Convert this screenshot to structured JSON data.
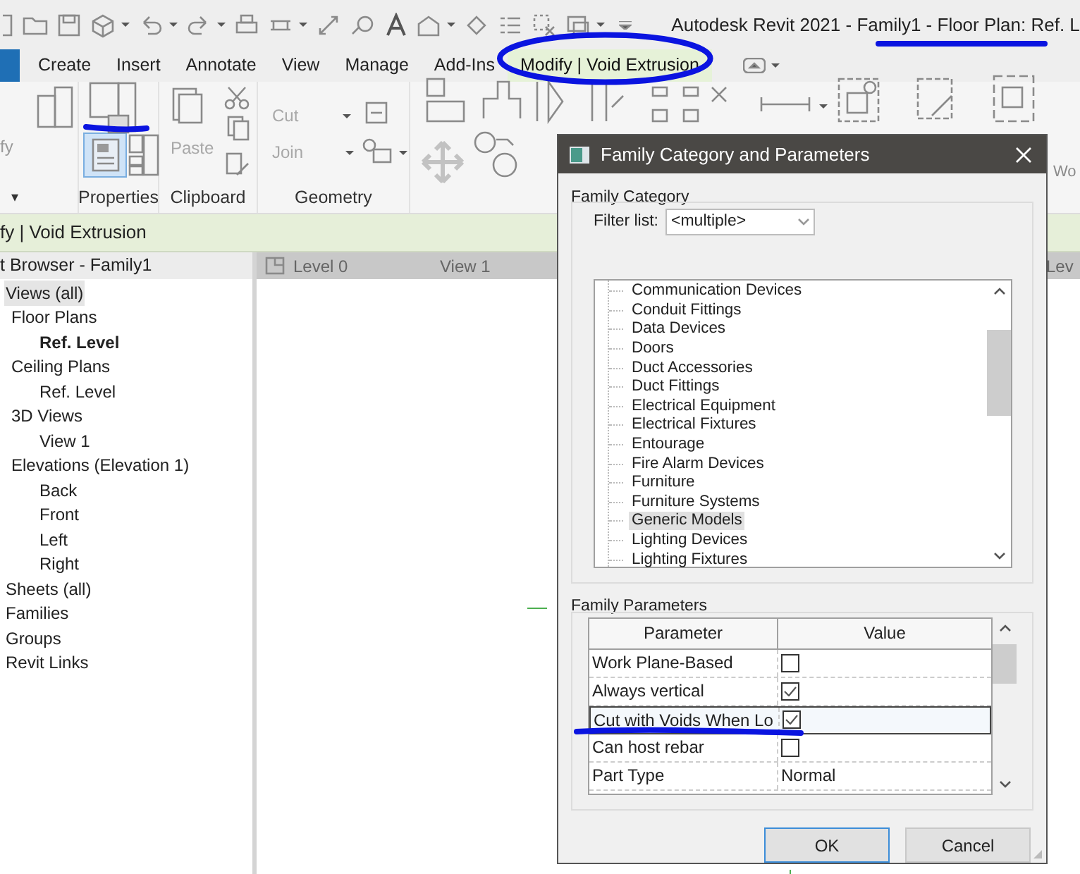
{
  "title_bar": {
    "title": "Autodesk Revit 2021 - Family1 - Floor Plan: Ref. L"
  },
  "ribbon_tabs": [
    {
      "label": "Create",
      "selected": false
    },
    {
      "label": "Insert",
      "selected": false
    },
    {
      "label": "Annotate",
      "selected": false
    },
    {
      "label": "View",
      "selected": false
    },
    {
      "label": "Manage",
      "selected": false
    },
    {
      "label": "Add-Ins",
      "selected": false
    },
    {
      "label": "Modify | Void Extrusion",
      "selected": true
    }
  ],
  "ribbon": {
    "cut_panel_text": "fy",
    "cut_panel_caret": "▾",
    "panels": [
      {
        "label": "Properties"
      },
      {
        "label": "Clipboard"
      },
      {
        "label": "Geometry"
      }
    ],
    "buttons": [
      {
        "label": "Paste",
        "disabled": true
      },
      {
        "label": "Cut",
        "disabled": true
      },
      {
        "label": "Join",
        "disabled": true
      }
    ],
    "edge_text": "Wo"
  },
  "context_bar": {
    "label": "fy | Void Extrusion"
  },
  "project_browser": {
    "title": "t Browser - Family1",
    "tree": [
      {
        "label": "Views (all)",
        "selected": true,
        "current": false,
        "children": [
          {
            "label": "Floor Plans",
            "selected": false,
            "current": false,
            "children": [
              {
                "label": "Ref. Level",
                "selected": false,
                "current": true
              }
            ]
          },
          {
            "label": "Ceiling Plans",
            "selected": false,
            "current": false,
            "children": [
              {
                "label": "Ref. Level",
                "selected": false,
                "current": false
              }
            ]
          },
          {
            "label": "3D Views",
            "selected": false,
            "current": false,
            "children": [
              {
                "label": "View 1",
                "selected": false,
                "current": false
              }
            ]
          },
          {
            "label": "Elevations (Elevation 1)",
            "selected": false,
            "current": false,
            "children": [
              {
                "label": "Back",
                "selected": false,
                "current": false
              },
              {
                "label": "Front",
                "selected": false,
                "current": false
              },
              {
                "label": "Left",
                "selected": false,
                "current": false
              },
              {
                "label": "Right",
                "selected": false,
                "current": false
              }
            ]
          }
        ]
      },
      {
        "label": "Sheets (all)",
        "selected": false,
        "current": false
      },
      {
        "label": "Families",
        "selected": false,
        "current": false
      },
      {
        "label": "Groups",
        "selected": false,
        "current": false
      },
      {
        "label": "Revit Links",
        "selected": false,
        "current": false
      }
    ]
  },
  "view_tabs": [
    {
      "label": "Level 0",
      "kind": "plan"
    },
    {
      "label": "View 1",
      "kind": "perspective"
    },
    {
      "label": "Lev",
      "kind": "plain"
    }
  ],
  "dialog": {
    "title": "Family Category and Parameters",
    "family_category": {
      "label": "Family Category",
      "filter_label": "Filter list:",
      "filter_value": "<multiple>",
      "categories": [
        {
          "label": "Communication Devices",
          "selected": false
        },
        {
          "label": "Conduit Fittings",
          "selected": false
        },
        {
          "label": "Data Devices",
          "selected": false
        },
        {
          "label": "Doors",
          "selected": false
        },
        {
          "label": "Duct Accessories",
          "selected": false
        },
        {
          "label": "Duct Fittings",
          "selected": false
        },
        {
          "label": "Electrical Equipment",
          "selected": false
        },
        {
          "label": "Electrical Fixtures",
          "selected": false
        },
        {
          "label": "Entourage",
          "selected": false
        },
        {
          "label": "Fire Alarm Devices",
          "selected": false
        },
        {
          "label": "Furniture",
          "selected": false
        },
        {
          "label": "Furniture Systems",
          "selected": false
        },
        {
          "label": "Generic Models",
          "selected": true
        },
        {
          "label": "Lighting Devices",
          "selected": false
        },
        {
          "label": "Lighting Fixtures",
          "selected": false
        }
      ]
    },
    "family_parameters": {
      "label": "Family Parameters",
      "columns": [
        "Parameter",
        "Value"
      ],
      "rows": [
        {
          "parameter": "Work Plane-Based",
          "kind": "checkbox",
          "checked": false,
          "selected": false
        },
        {
          "parameter": "Always vertical",
          "kind": "checkbox",
          "checked": true,
          "selected": false
        },
        {
          "parameter": "Cut with Voids When Lo",
          "kind": "checkbox",
          "checked": true,
          "selected": true
        },
        {
          "parameter": "Can host rebar",
          "kind": "checkbox",
          "checked": false,
          "selected": false
        },
        {
          "parameter": "Part Type",
          "kind": "text",
          "value": "Normal",
          "selected": false
        }
      ]
    },
    "buttons": [
      {
        "label": "OK",
        "default": true
      },
      {
        "label": "Cancel",
        "default": false
      }
    ]
  }
}
